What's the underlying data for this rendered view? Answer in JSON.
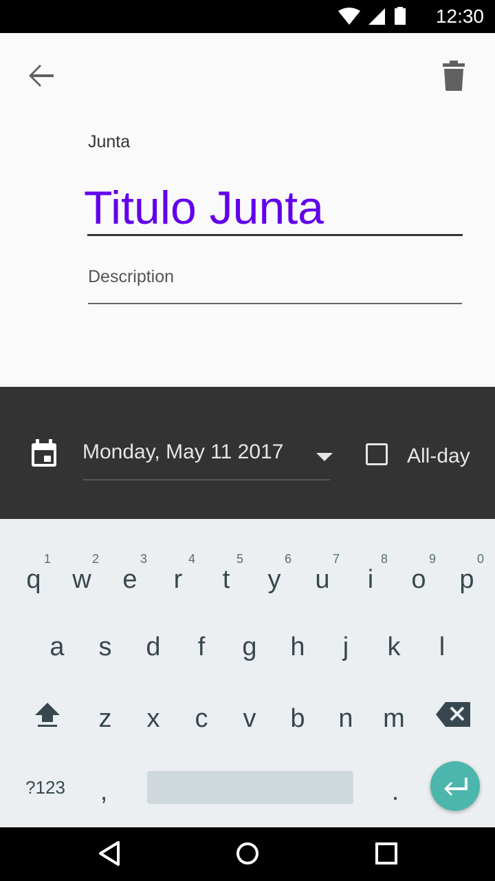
{
  "status_bar": {
    "time": "12:30"
  },
  "event": {
    "calendar_name": "Junta",
    "title": "Titulo Junta",
    "description_placeholder": "Description"
  },
  "datetime": {
    "date": "Monday, May 11 2017",
    "all_day_label": "All-day",
    "all_day_checked": false
  },
  "keyboard": {
    "row1": [
      {
        "key": "q",
        "hint": "1"
      },
      {
        "key": "w",
        "hint": "2"
      },
      {
        "key": "e",
        "hint": "3"
      },
      {
        "key": "r",
        "hint": "4"
      },
      {
        "key": "t",
        "hint": "5"
      },
      {
        "key": "y",
        "hint": "6"
      },
      {
        "key": "u",
        "hint": "7"
      },
      {
        "key": "i",
        "hint": "8"
      },
      {
        "key": "o",
        "hint": "9"
      },
      {
        "key": "p",
        "hint": "0"
      }
    ],
    "row2": [
      "a",
      "s",
      "d",
      "f",
      "g",
      "h",
      "j",
      "k",
      "l"
    ],
    "row3": [
      "z",
      "x",
      "c",
      "v",
      "b",
      "n",
      "m"
    ],
    "symbols_key": "?123",
    "comma_key": ",",
    "period_key": "."
  },
  "colors": {
    "accent": "#6200ea",
    "dark_panel": "#333333",
    "keyboard_bg": "#eceff1",
    "enter_button": "#4db6ac"
  },
  "icons": [
    "wifi-icon",
    "signal-icon",
    "battery-icon",
    "back-arrow-icon",
    "trash-icon",
    "calendar-icon",
    "dropdown-caret-icon",
    "checkbox-icon",
    "shift-icon",
    "backspace-icon",
    "enter-icon",
    "nav-back-icon",
    "nav-home-icon",
    "nav-recents-icon"
  ]
}
